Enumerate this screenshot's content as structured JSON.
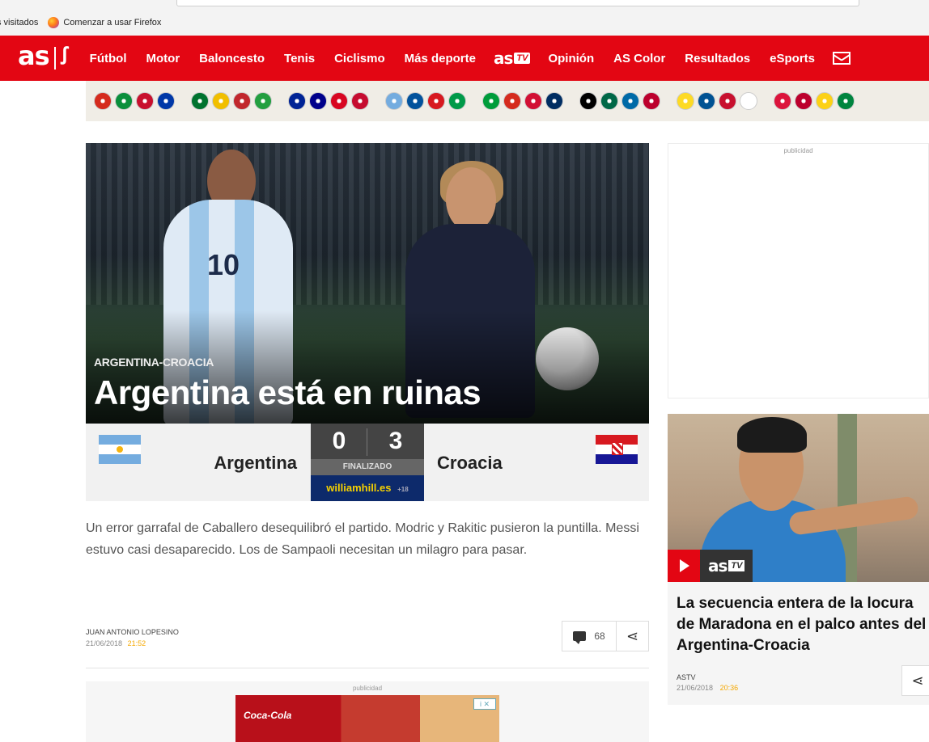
{
  "browser": {
    "bookmarks": [
      {
        "label": "s visitados"
      },
      {
        "label": "Comenzar a usar Firefox"
      }
    ]
  },
  "nav": {
    "logo_text": "as",
    "logo_mark": "ꭍ",
    "items": [
      "Fútbol",
      "Motor",
      "Baloncesto",
      "Tenis",
      "Ciclismo",
      "Más deporte"
    ],
    "astv": {
      "as": "as",
      "tv": "TV"
    },
    "items_right": [
      "Opinión",
      "AS Color",
      "Resultados",
      "eSports"
    ],
    "brand_color": "#e30613"
  },
  "flags": [
    [
      "#d52b1e",
      "#0a8f3c",
      "#c8102e",
      "#0038a8"
    ],
    [
      "#00732f",
      "#f1bf00",
      "#c1272d",
      "#239f40"
    ],
    [
      "#002395",
      "#00008b",
      "#d80621",
      "#c60c30"
    ],
    [
      "#74acdf",
      "#02529c",
      "#d71920",
      "#009a49"
    ],
    [
      "#009c3b",
      "#d52b1e",
      "#d21034",
      "#002d62"
    ],
    [
      "#000000",
      "#006847",
      "#006aa7",
      "#bc002d"
    ],
    [
      "#fdda24",
      "#005293",
      "#c8102e",
      "#ffffff"
    ],
    [
      "#dc143c",
      "#bc002d",
      "#fcd116",
      "#00853f"
    ]
  ],
  "hero": {
    "kicker": "ARGENTINA-CROACIA",
    "title": "Argentina está en ruinas",
    "jersey_number": "10"
  },
  "match": {
    "home_team": "Argentina",
    "away_team": "Croacia",
    "home_score": "0",
    "away_score": "3",
    "status": "FINALIZADO",
    "sponsor": "williamhill.es",
    "sponsor_age": "+18"
  },
  "article": {
    "summary": "Un error garrafal de Caballero desequilibró el partido. Modric y Rakitic pusieron la puntilla. Messi estuvo casi desaparecido. Los de Sampaoli necesitan un milagro para pasar.",
    "author": "JUAN ANTONIO LOPESINO",
    "date": "21/06/2018",
    "time": "21:52",
    "comments_count": "68"
  },
  "ads": {
    "label": "publicidad",
    "bottom_brand": "Coca-Cola",
    "adchoices": "i ✕"
  },
  "side_story": {
    "brand": {
      "as": "as",
      "tv": "TV"
    },
    "title": "La secuencia entera de la locura de Maradona en el palco antes del Argentina-Croacia",
    "source": "ASTV",
    "date": "21/06/2018",
    "time": "20:36"
  }
}
